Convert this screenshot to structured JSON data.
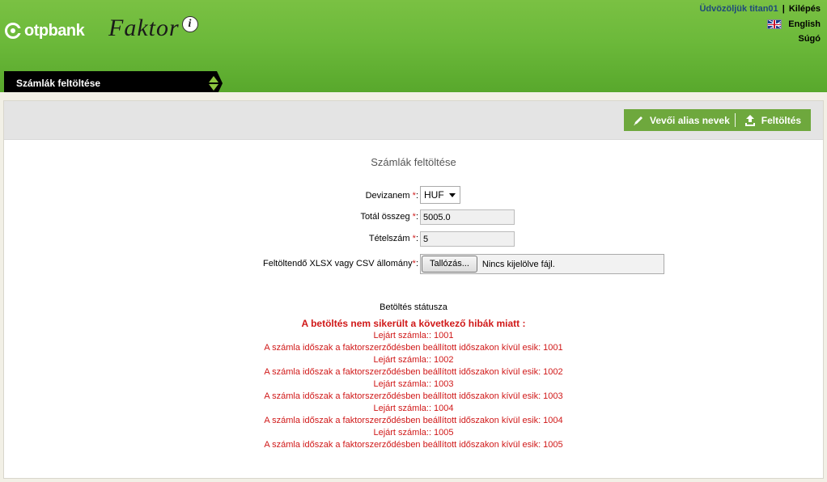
{
  "header": {
    "brand": "otpbank",
    "product": "Faktor",
    "product_badge": "i",
    "welcome": "Üdvözöljük titan01",
    "separator": "|",
    "logout": "Kilépés",
    "language": "English",
    "help": "Súgó"
  },
  "nav": {
    "active_tab": "Számlák feltöltése"
  },
  "toolbar": {
    "alias_label": "Vevői alias nevek",
    "upload_label": "Feltöltés"
  },
  "form": {
    "title": "Számlák feltöltése",
    "currency_label": "Devizanem",
    "currency_value": "HUF",
    "total_label": "Totál összeg",
    "total_value": "5005.0",
    "count_label": "Tételszám",
    "count_value": "5",
    "file_label": "Feltöltendő XLSX vagy CSV állomány",
    "required_mark": "*",
    "label_suffix": ":",
    "browse_label": "Tallózás...",
    "file_status": "Nincs kijelölve fájl."
  },
  "status": {
    "title": "Betöltés státusza",
    "headline": "A betöltés nem sikerült a következő hibák miatt :",
    "messages": [
      "Lejárt számla:: 1001",
      "A számla időszak a faktorszerződésben beállított időszakon kívül esik: 1001",
      "Lejárt számla:: 1002",
      "A számla időszak a faktorszerződésben beállított időszakon kívül esik: 1002",
      "Lejárt számla:: 1003",
      "A számla időszak a faktorszerződésben beállított időszakon kívül esik: 1003",
      "Lejárt számla:: 1004",
      "A számla időszak a faktorszerződésben beállított időszakon kívül esik: 1004",
      "Lejárt számla:: 1005",
      "A számla időszak a faktorszerződésben beállított időszakon kívül esik: 1005"
    ]
  },
  "colors": {
    "header_green": "#6cb93a",
    "action_green": "#6ea83d",
    "error_red": "#d01818"
  }
}
